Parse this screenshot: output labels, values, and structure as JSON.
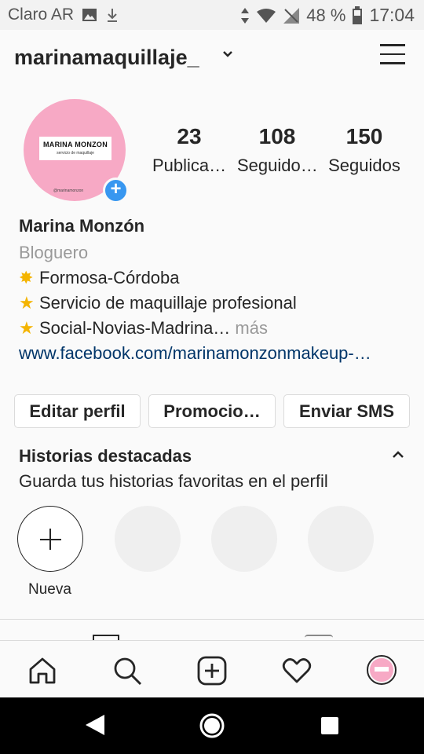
{
  "status_bar": {
    "carrier": "Claro AR",
    "battery": "48 %",
    "time": "17:04"
  },
  "header": {
    "username": "marinamaquillaje_",
    "dropdown_icon": "chevron-down-icon",
    "menu_icon": "hamburger-menu-icon"
  },
  "profile": {
    "avatar_logo_title": "MARINA MONZON",
    "avatar_logo_subtitle": "servicio de maquillaje",
    "avatar_logo_handle": "@marinamonzon",
    "stats": [
      {
        "value": "23",
        "label": "Publica…"
      },
      {
        "value": "108",
        "label": "Seguido…"
      },
      {
        "value": "150",
        "label": "Seguidos"
      }
    ]
  },
  "bio": {
    "name": "Marina Monzón",
    "category": "Bloguero",
    "lines": [
      "Formosa-Córdoba",
      "Servicio de maquillaje profesional",
      "Social-Novias-Madrina…"
    ],
    "more": " más",
    "link": "www.facebook.com/marinamonzonmakeup-…"
  },
  "buttons": {
    "edit": "Editar perfil",
    "promo": "Promocio…",
    "sms": "Enviar SMS"
  },
  "highlights": {
    "title": "Historias destacadas",
    "subtitle": "Guarda tus historias favoritas en el perfil",
    "new_label": "Nueva"
  },
  "colors": {
    "accent_blue": "#3897f0",
    "link_blue": "#003569",
    "avatar_pink": "#f7a9c5",
    "star_yellow": "#f4b400"
  }
}
